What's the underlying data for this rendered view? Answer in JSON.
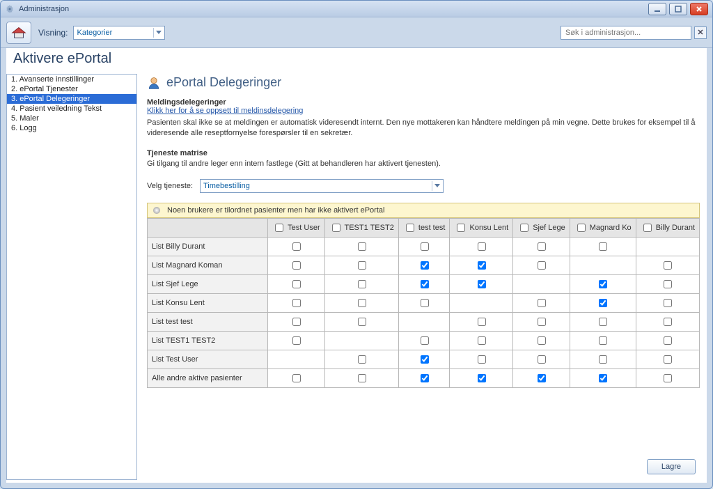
{
  "window": {
    "title": "Administrasjon"
  },
  "toolbar": {
    "view_label": "Visning:",
    "view_value": "Kategorier",
    "search_placeholder": "Søk i administrasjon..."
  },
  "page": {
    "title": "Aktivere ePortal"
  },
  "sidebar": {
    "items": [
      {
        "label": "1. Avanserte innstillinger",
        "selected": false
      },
      {
        "label": "2. ePortal Tjenester",
        "selected": false
      },
      {
        "label": "3. ePortal Delegeringer",
        "selected": true
      },
      {
        "label": "4. Pasient veiledning Tekst",
        "selected": false
      },
      {
        "label": "5. Maler",
        "selected": false
      },
      {
        "label": "6. Logg",
        "selected": false
      }
    ]
  },
  "content": {
    "heading": "ePortal Delegeringer",
    "msg_sub": "Meldingsdelegeringer",
    "msg_link": "Klikk her for å se oppsett til meldinsdelegering",
    "msg_desc": "Pasienten skal ikke se at meldingen er automatisk videresendt internt. Den nye mottakeren kan håndtere meldingen på min vegne. Dette brukes for eksempel til å videresende alle reseptfornyelse forespørsler til en sekretær.",
    "matrix_sub": "Tjeneste matrise",
    "matrix_desc": "Gi tilgang til andre leger enn intern fastlege (Gitt at behandleren har aktivert tjenesten).",
    "select_label": "Velg tjeneste:",
    "select_value": "Timebestilling",
    "notice": "Noen brukere er tilordnet pasienter men har ikke aktivert ePortal"
  },
  "matrix": {
    "columns": [
      {
        "label": "Test User",
        "header_checked": false,
        "highlight": false
      },
      {
        "label": "TEST1 TEST2",
        "header_checked": false,
        "highlight": false
      },
      {
        "label": "test test",
        "header_checked": false,
        "highlight": false
      },
      {
        "label": "Konsu Lent",
        "header_checked": false,
        "highlight": true
      },
      {
        "label": "Sjef Lege",
        "header_checked": false,
        "highlight": false
      },
      {
        "label": "Magnard Ko",
        "header_checked": false,
        "highlight": false
      },
      {
        "label": "Billy Durant",
        "header_checked": false,
        "highlight": false
      }
    ],
    "rows": [
      {
        "label": "List Billy Durant",
        "cells": [
          false,
          false,
          false,
          false,
          false,
          false,
          null
        ]
      },
      {
        "label": "List Magnard Koman",
        "cells": [
          false,
          false,
          true,
          true,
          false,
          null,
          false
        ]
      },
      {
        "label": "List Sjef Lege",
        "cells": [
          false,
          false,
          true,
          true,
          null,
          true,
          false
        ]
      },
      {
        "label": "List Konsu Lent",
        "cells": [
          false,
          false,
          false,
          null,
          false,
          true,
          false
        ]
      },
      {
        "label": "List test test",
        "cells": [
          false,
          false,
          null,
          false,
          false,
          false,
          false
        ]
      },
      {
        "label": "List TEST1 TEST2",
        "cells": [
          false,
          null,
          false,
          false,
          false,
          false,
          false
        ]
      },
      {
        "label": "List Test User",
        "cells": [
          null,
          false,
          true,
          false,
          false,
          false,
          false
        ]
      },
      {
        "label": "Alle andre aktive pasienter",
        "cells": [
          false,
          false,
          true,
          true,
          true,
          true,
          false
        ]
      }
    ]
  },
  "buttons": {
    "save": "Lagre"
  }
}
